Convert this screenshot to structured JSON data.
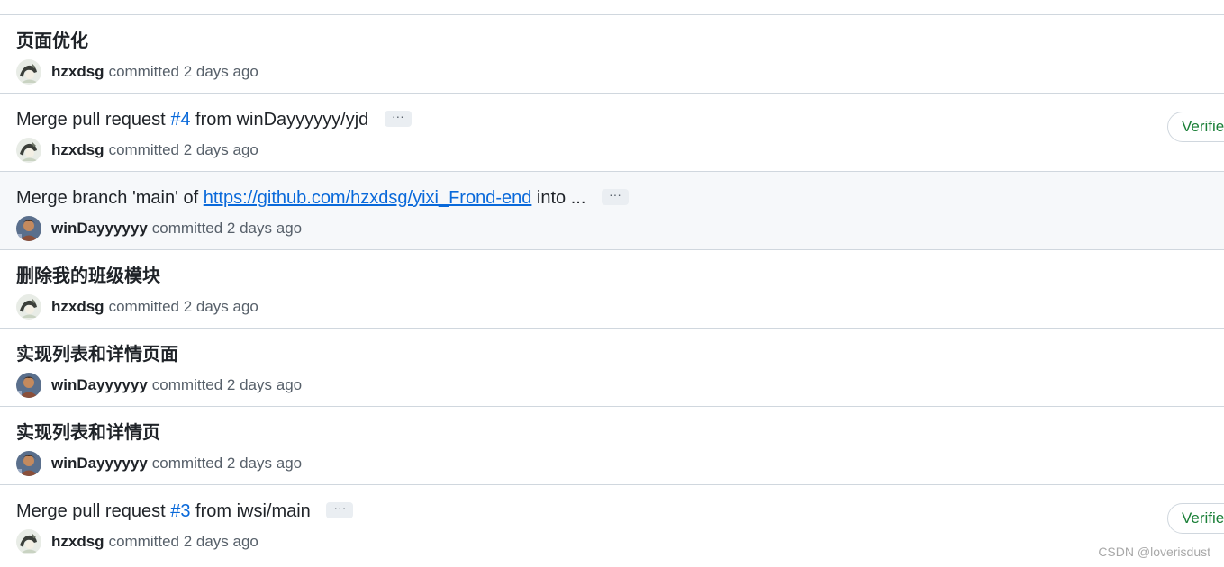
{
  "commits": [
    {
      "title": "页面优化",
      "author": "hzxdsg",
      "committed_text": "committed 2 days ago",
      "avatar": "hzxdsg-avatar"
    },
    {
      "title_prefix": "Merge pull request ",
      "pr_ref": "#4",
      "title_suffix": " from winDayyyyyy/yjd",
      "ellipsis": "···",
      "author": "hzxdsg",
      "committed_text": "committed 2 days ago",
      "badge": "Verified",
      "avatar": "hzxdsg-avatar"
    },
    {
      "title_prefix": "Merge branch 'main' of ",
      "url": "https://github.com/hzxdsg/yixi_Frond-end",
      "title_suffix": " into ...",
      "ellipsis": "···",
      "author": "winDayyyyyy",
      "committed_text": "committed 2 days ago",
      "avatar": "windayyyyyy-avatar"
    },
    {
      "title": "删除我的班级模块",
      "author": "hzxdsg",
      "committed_text": "committed 2 days ago",
      "avatar": "hzxdsg-avatar"
    },
    {
      "title": "实现列表和详情页面",
      "author": "winDayyyyyy",
      "committed_text": "committed 2 days ago",
      "avatar": "windayyyyyy-avatar"
    },
    {
      "title": "实现列表和详情页",
      "author": "winDayyyyyy",
      "committed_text": "committed 2 days ago",
      "avatar": "windayyyyyy-avatar"
    },
    {
      "title_prefix": "Merge pull request ",
      "pr_ref": "#3",
      "title_suffix": " from iwsi/main",
      "ellipsis": "···",
      "author": "hzxdsg",
      "committed_text": "committed 2 days ago",
      "badge": "Verified",
      "avatar": "hzxdsg-avatar"
    }
  ],
  "watermark": "CSDN @loverisdust",
  "colors": {
    "link": "#0969da",
    "verified": "#1a7f37",
    "muted": "#57606a",
    "border": "#d0d7de",
    "highlight_bg": "#f6f8fa"
  }
}
